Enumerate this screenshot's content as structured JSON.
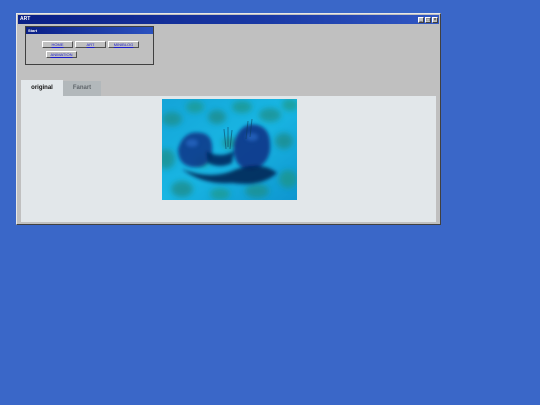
{
  "window": {
    "title": "ART",
    "min_glyph": "_",
    "max_glyph": "□",
    "close_glyph": "×"
  },
  "start_panel": {
    "title": "Start",
    "nav": [
      "HOME",
      "ART",
      "MINIBLOG",
      "ANIMATION"
    ]
  },
  "tabs": [
    "original",
    "Fanart"
  ],
  "active_tab": "original",
  "artwork": {
    "description_icon": "painting-icon"
  },
  "colors": {
    "desktop": "#3a67c8",
    "titlebar": "#0a1f86",
    "window": "#c0c0c0",
    "content": "#e2e7ea",
    "link": "#1b1bcf"
  }
}
